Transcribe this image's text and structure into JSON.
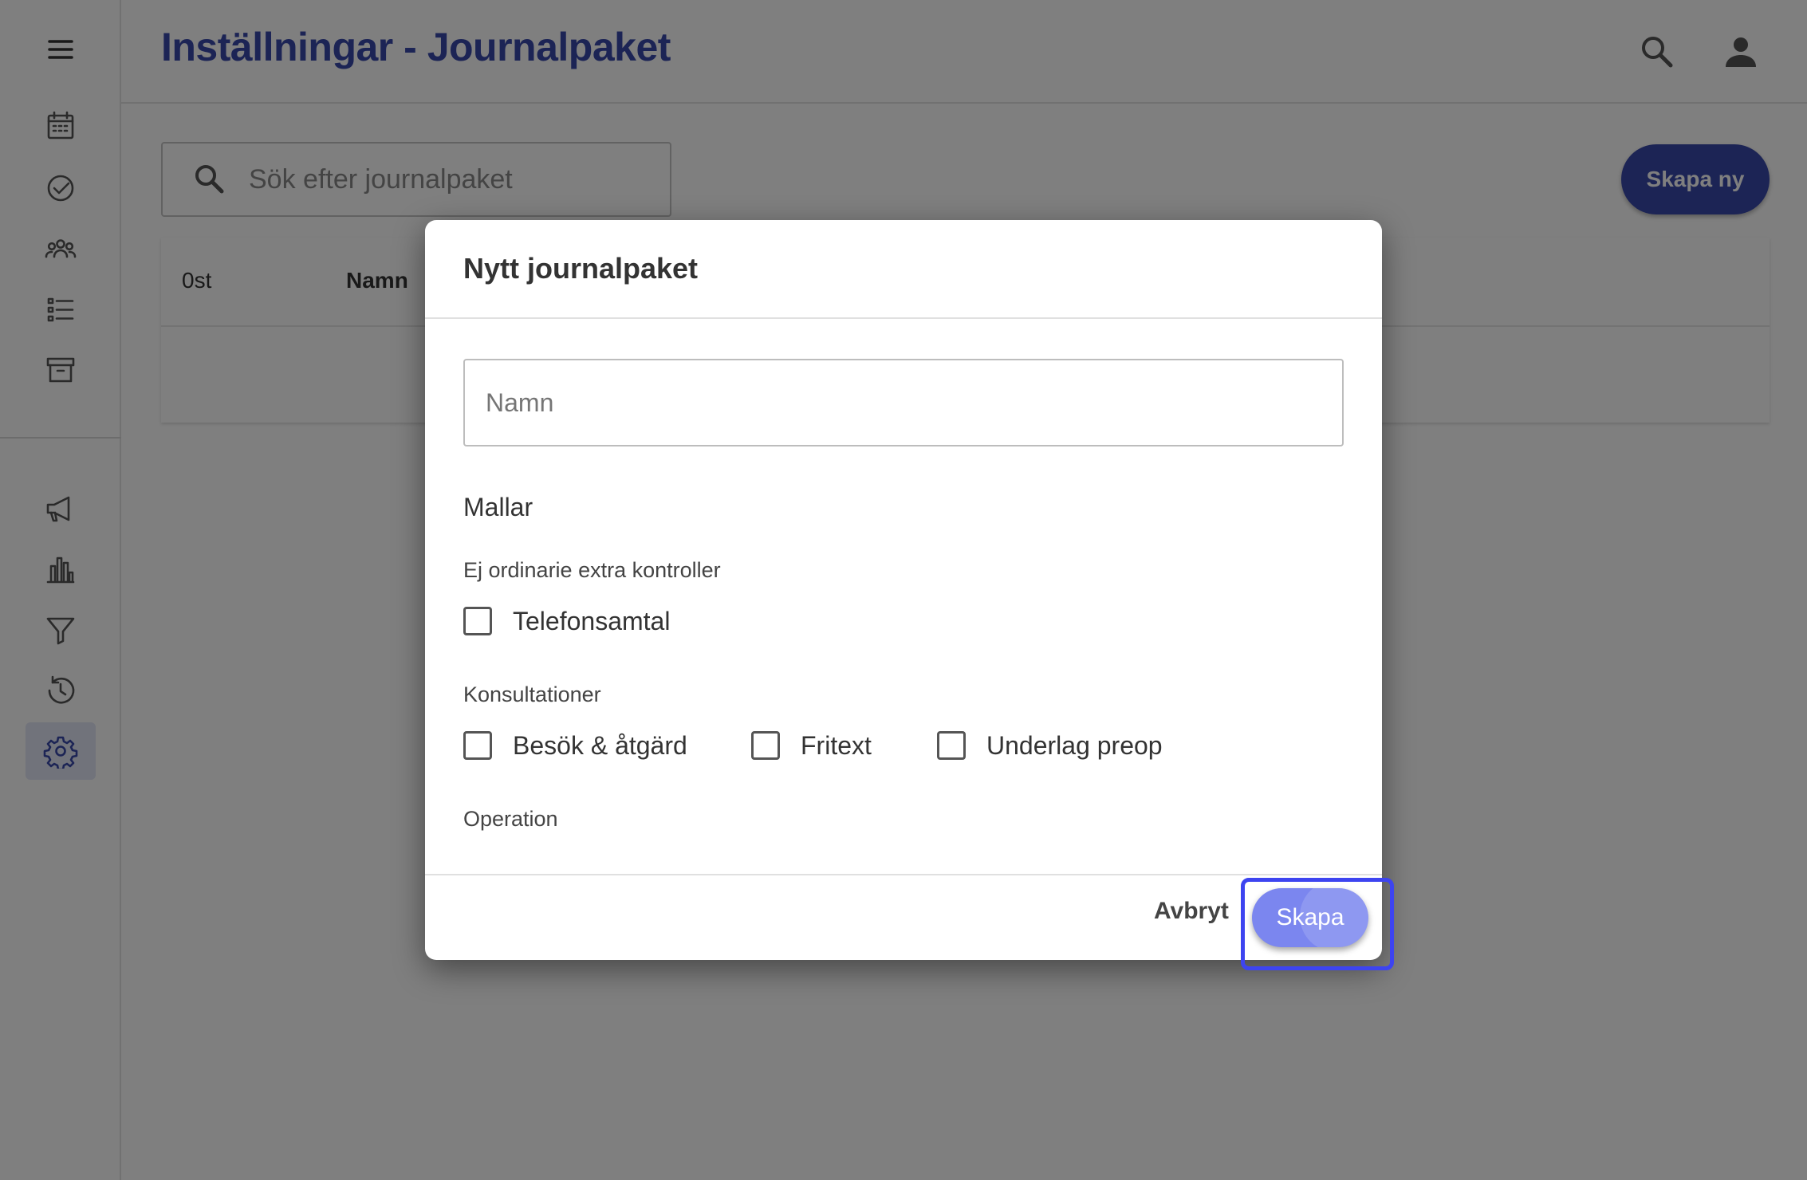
{
  "header": {
    "title": "Inställningar - Journalpaket",
    "icons": [
      "search-icon",
      "account-icon"
    ]
  },
  "sidebar": {
    "items": [
      {
        "icon": "menu-icon"
      },
      {
        "icon": "calendar-icon"
      },
      {
        "icon": "check-circle-icon"
      },
      {
        "icon": "group-icon"
      },
      {
        "icon": "list-icon"
      },
      {
        "icon": "archive-icon"
      },
      {
        "icon": "megaphone-icon"
      },
      {
        "icon": "bar-chart-icon"
      },
      {
        "icon": "filter-icon"
      },
      {
        "icon": "history-icon"
      },
      {
        "icon": "settings-icon",
        "active": true
      }
    ]
  },
  "main": {
    "search": {
      "placeholder": "Sök efter journalpaket"
    },
    "create_new_label": "Skapa ny",
    "table": {
      "count_label": "0st",
      "columns": [
        "Namn"
      ]
    }
  },
  "dialog": {
    "title": "Nytt journalpaket",
    "name_field": {
      "placeholder": "Namn",
      "value": ""
    },
    "templates_label": "Mallar",
    "groups": [
      {
        "label": "Ej ordinarie extra kontroller",
        "options": [
          {
            "label": "Telefonsamtal",
            "checked": false
          }
        ]
      },
      {
        "label": "Konsultationer",
        "options": [
          {
            "label": "Besök & åtgärd",
            "checked": false
          },
          {
            "label": "Fritext",
            "checked": false
          },
          {
            "label": "Underlag preop",
            "checked": false
          }
        ]
      },
      {
        "label": "Operation",
        "options": []
      }
    ],
    "cancel_label": "Avbryt",
    "create_label": "Skapa"
  },
  "colors": {
    "primary": "#3949ab",
    "create_button": "#7b86ef",
    "focus_ring": "#3d44f0",
    "active_nav_bg": "#e3e6f6"
  }
}
